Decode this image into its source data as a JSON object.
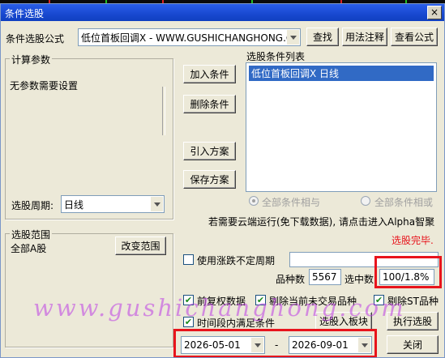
{
  "window": {
    "title": "条件选股",
    "close_glyph": "×"
  },
  "formula": {
    "label": "条件选股公式",
    "value": "低位首板回调X  -  WWW.GUSHICHANGHONG.COM",
    "buttons": {
      "find": "查找",
      "usage": "用法注释",
      "view": "查看公式"
    }
  },
  "params": {
    "title": "计算参数",
    "text": "无参数需要设置"
  },
  "condition_buttons": {
    "add": "加入条件",
    "delete": "删除条件",
    "import": "引入方案",
    "save": "保存方案"
  },
  "condition_list": {
    "title": "选股条件列表",
    "items": [
      "低位首板回调X  日线"
    ]
  },
  "period": {
    "label": "选股周期:",
    "value": "日线"
  },
  "logic": {
    "and_label": "全部条件相与",
    "or_label": "全部条件相或"
  },
  "cloud_notice": "若需要云端运行(免下载数据), 请点击进入Alpha智聚",
  "status": {
    "text": "选股完毕.",
    "color": "#e8141c"
  },
  "scope": {
    "title": "选股范围",
    "value": "全部A股",
    "change_button": "改变范围"
  },
  "options": {
    "use_limit_cycle": "使用涨跌不定周期",
    "count_label": "品种数",
    "count_value": "5567",
    "selected_label": "选中数",
    "selected_value": "100/1.8%",
    "adjusted": "前复权数据",
    "exclude_non_trading": "剔除当前未交易品种",
    "exclude_st": "剔除ST品种",
    "time_range": "时间段内满足条件"
  },
  "actions": {
    "select_to_block": "选股入板块",
    "run": "执行选股",
    "close": "关闭"
  },
  "date_range": {
    "start": "2026-05-01",
    "separator": "-",
    "end": "2026-09-01"
  },
  "watermark": "www.gushichanghong.com",
  "colors": {
    "highlight": "#e8141c",
    "selection_bg": "#316ac5",
    "title_bg": "#1848d0"
  }
}
